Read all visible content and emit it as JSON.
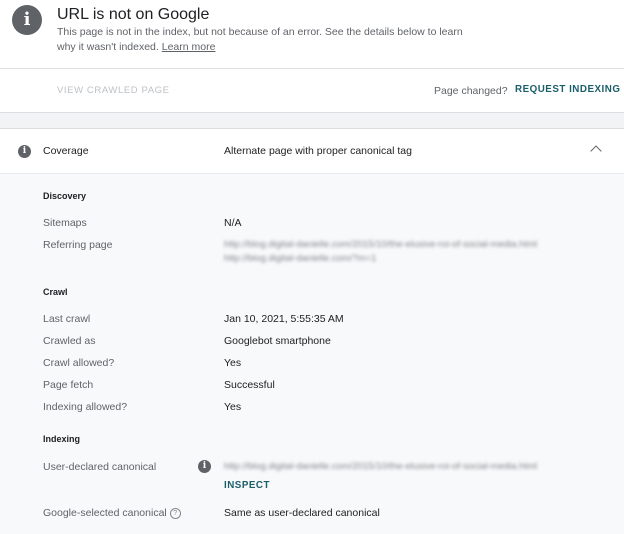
{
  "header": {
    "title": "URL is not on Google",
    "description": "This page is not in the index, but not because of an error. See the details below to learn why it wasn't indexed.",
    "learn_more": "Learn more"
  },
  "actions": {
    "view_crawled": "VIEW CRAWLED PAGE",
    "page_changed": "Page changed?",
    "request_indexing": "REQUEST INDEXING"
  },
  "coverage": {
    "label": "Coverage",
    "value": "Alternate page with proper canonical tag"
  },
  "discovery": {
    "title": "Discovery",
    "sitemaps_label": "Sitemaps",
    "sitemaps_value": "N/A",
    "referring_label": "Referring page",
    "referring_value_1": "http://blog.digital-danielle.com/2015/10/the-elusive-roi-of-social-media.html",
    "referring_value_2": "http://blog.digital-danielle.com/?m=1"
  },
  "crawl": {
    "title": "Crawl",
    "last_crawl_label": "Last crawl",
    "last_crawl_value": "Jan 10, 2021, 5:55:35 AM",
    "crawled_as_label": "Crawled as",
    "crawled_as_value": "Googlebot smartphone",
    "crawl_allowed_label": "Crawl allowed?",
    "crawl_allowed_value": "Yes",
    "page_fetch_label": "Page fetch",
    "page_fetch_value": "Successful",
    "indexing_allowed_label": "Indexing allowed?",
    "indexing_allowed_value": "Yes"
  },
  "indexing": {
    "title": "Indexing",
    "user_canonical_label": "User-declared canonical",
    "user_canonical_value": "http://blog.digital-danielle.com/2015/10/the-elusive-roi-of-social-media.html",
    "inspect": "INSPECT",
    "google_canonical_label": "Google-selected canonical",
    "google_canonical_value": "Same as user-declared canonical"
  },
  "icons": {
    "info": "info-icon",
    "help": "help-icon",
    "collapse": "chevron-up-icon"
  },
  "colors": {
    "accent": "#1a5e6a",
    "icon_gray": "#5f6368"
  }
}
